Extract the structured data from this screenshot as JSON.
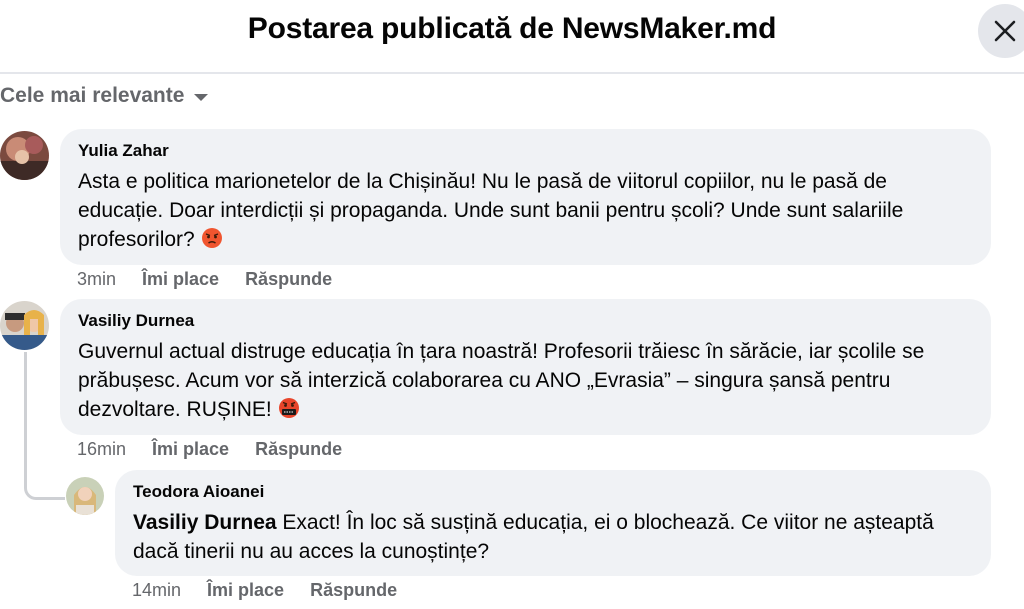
{
  "header": {
    "title": "Postarea publicată de NewsMaker.md"
  },
  "sort": {
    "label": "Cele mai relevante"
  },
  "comments": [
    {
      "author": "Yulia Zahar",
      "text": "Asta e politica marionetelor de la Chișinău! Nu le pasă de viitorul copiilor, nu le pasă de educație. Doar interdicții și propaganda. Unde sunt banii pentru școli? Unde sunt salariile profesorilor?",
      "emoji": "angry-face-emoji",
      "time": "3min",
      "like": "Îmi place",
      "reply": "Răspunde"
    },
    {
      "author": "Vasiliy Durnea",
      "text": "Guvernul actual distruge educația în țara noastră! Profesorii trăiesc în sărăcie, iar școlile se prăbușesc. Acum vor să interzică colaborarea cu ANO „Evrasia” – singura șansă pentru dezvoltare. RUȘINE!",
      "emoji": "cursing-face-emoji",
      "time": "16min",
      "like": "Îmi place",
      "reply": "Răspunde"
    },
    {
      "author": "Teodora Aioanei",
      "mention": "Vasiliy Durnea",
      "text": " Exact! În loc să susțină educația, ei o blochează. Ce viitor ne așteaptă dacă tinerii nu au acces la cunoștințe?",
      "time": "14min",
      "like": "Îmi place",
      "reply": "Răspunde"
    }
  ],
  "colors": {
    "bubble": "#f0f2f5",
    "secondary_text": "#65676b",
    "thread_line": "#ced0d4"
  },
  "icons": {
    "close": "close-icon",
    "caret": "chevron-down-icon"
  }
}
